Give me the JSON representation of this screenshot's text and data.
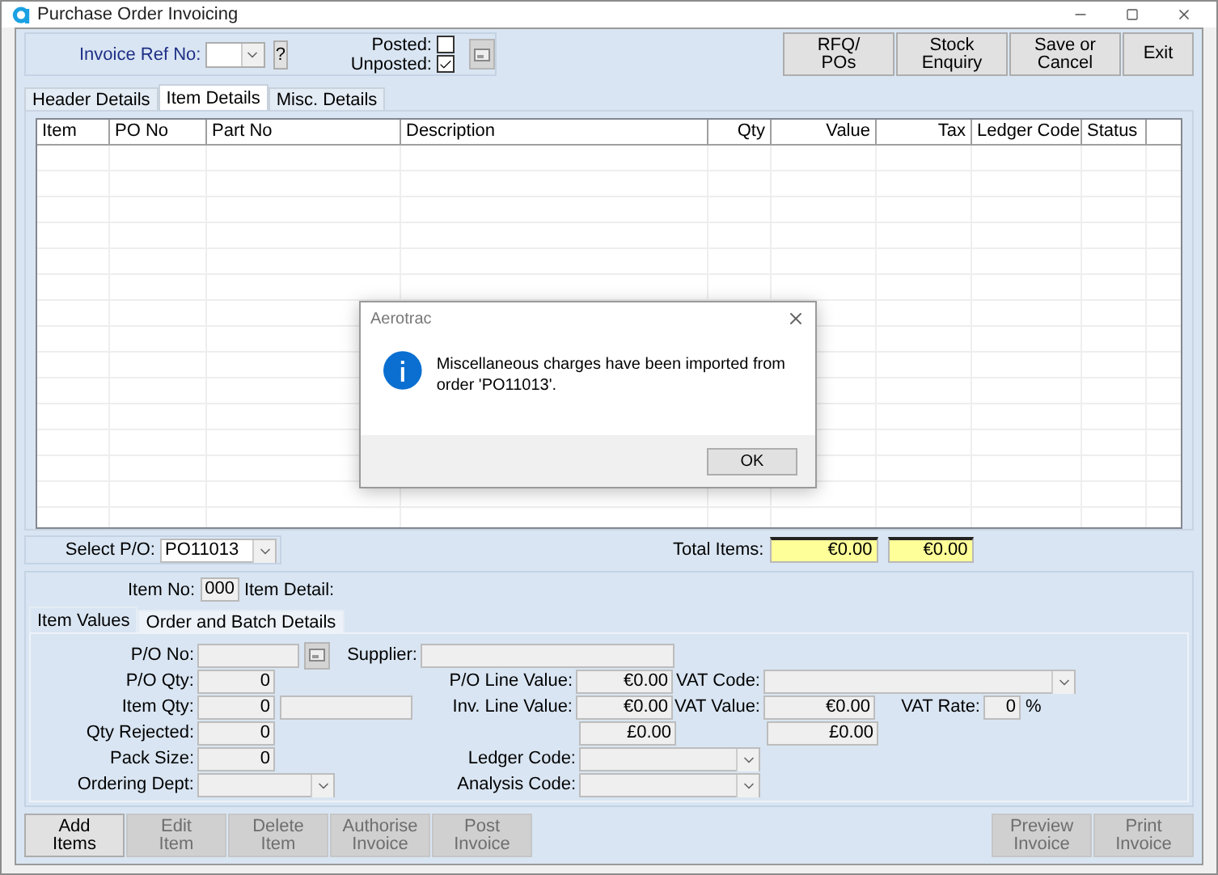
{
  "window": {
    "title": "Purchase Order Invoicing"
  },
  "header": {
    "invoice_ref": {
      "label": "Invoice Ref No:",
      "help": "?"
    },
    "posted": {
      "label": "Posted:",
      "checked": false
    },
    "unposted": {
      "label": "Unposted:",
      "checked": true
    }
  },
  "toolbar_buttons": [
    {
      "lines": [
        "RFQ/",
        "POs"
      ]
    },
    {
      "lines": [
        "Stock",
        "Enquiry"
      ]
    },
    {
      "lines": [
        "Save or",
        "Cancel"
      ]
    },
    {
      "lines": [
        "Exit"
      ]
    }
  ],
  "tabs": [
    {
      "label": "Header Details",
      "selected": false
    },
    {
      "label": "Item Details",
      "selected": true
    },
    {
      "label": "Misc. Details",
      "selected": false
    }
  ],
  "table": {
    "columns": [
      {
        "label": "Item",
        "kind": "text"
      },
      {
        "label": "PO No",
        "kind": "text"
      },
      {
        "label": "Part No",
        "kind": "text"
      },
      {
        "label": "Description",
        "kind": "text"
      },
      {
        "label": "Qty",
        "kind": "number"
      },
      {
        "label": "Value",
        "kind": "number"
      },
      {
        "label": "Tax",
        "kind": "number"
      },
      {
        "label": "Ledger Code",
        "kind": "text"
      },
      {
        "label": "Status",
        "kind": "text"
      }
    ]
  },
  "select_po": {
    "label": "Select P/O:",
    "value": "PO11013"
  },
  "totals": {
    "label": "Total Items:",
    "values": [
      "€0.00",
      "€0.00"
    ]
  },
  "item": {
    "label": "Item No:",
    "value": "000",
    "detail_label": "Item Detail:"
  },
  "item_tabs": [
    {
      "label": "Item Values",
      "selected": true
    },
    {
      "label": "Order and Batch Details",
      "selected": false
    }
  ],
  "item_rows": [
    [
      {
        "label": "P/O No:",
        "kind": "text"
      },
      {
        "kind": "lookup"
      },
      {
        "label": "Supplier:",
        "kind": "text"
      }
    ],
    [
      {
        "label": "P/O Qty:",
        "kind": "text",
        "value": "0"
      },
      {
        "label": "P/O Line Value:",
        "kind": "text",
        "value": "€0.00"
      },
      {
        "label": "VAT Code:",
        "kind": "dropdown"
      }
    ],
    [
      {
        "label": "Item Qty:",
        "kind": "text",
        "value": "0"
      },
      {
        "kind": "text"
      },
      {
        "label": "Inv. Line Value:",
        "kind": "text",
        "value": "€0.00"
      },
      {
        "label": "VAT Value:",
        "kind": "text",
        "value": "€0.00"
      },
      {
        "label": "VAT Rate:",
        "kind": "text",
        "value": "0"
      },
      {
        "kind": "unit",
        "value": "%"
      }
    ],
    [
      {
        "label": "Qty Rejected:",
        "kind": "text",
        "value": "0"
      },
      {
        "kind": "text",
        "value": "£0.00"
      },
      {
        "kind": "text",
        "value": "£0.00"
      }
    ],
    [
      {
        "label": "Pack Size:",
        "kind": "text",
        "value": "0"
      },
      {
        "label": "Ledger Code:",
        "kind": "dropdown"
      }
    ],
    [
      {
        "label": "Ordering Dept:",
        "kind": "dropdown"
      },
      {
        "label": "Analysis Code:",
        "kind": "dropdown"
      }
    ]
  ],
  "actions": [
    {
      "lines": [
        "Add",
        "Items"
      ],
      "disabled": false
    },
    {
      "lines": [
        "Edit",
        "Item"
      ],
      "disabled": true
    },
    {
      "lines": [
        "Delete",
        "Item"
      ],
      "disabled": true
    },
    {
      "lines": [
        "Authorise",
        "Invoice"
      ],
      "disabled": true
    },
    {
      "lines": [
        "Post",
        "Invoice"
      ],
      "disabled": true
    }
  ],
  "report_actions": [
    {
      "lines": [
        "Preview",
        "Invoice"
      ],
      "disabled": true
    },
    {
      "lines": [
        "Print",
        "Invoice"
      ],
      "disabled": true
    }
  ],
  "dialog": {
    "title": "Aerotrac",
    "message": "Miscellaneous charges have been imported from order 'PO11013'.",
    "button": "OK"
  }
}
